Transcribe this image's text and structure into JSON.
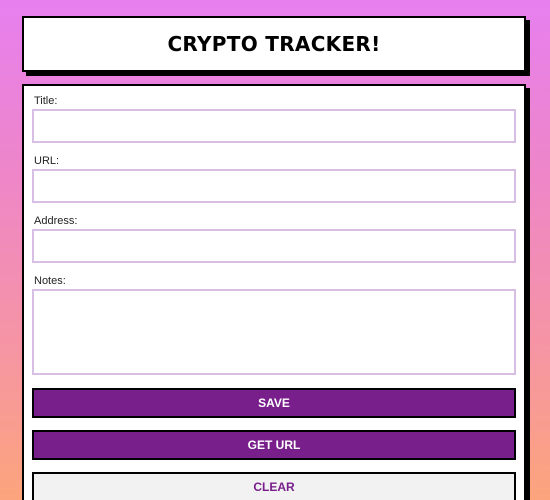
{
  "header": {
    "title": "CRYPTO TRACKER!"
  },
  "form": {
    "fields": [
      {
        "label": "Title:",
        "value": "",
        "placeholder": ""
      },
      {
        "label": "URL:",
        "value": "",
        "placeholder": ""
      },
      {
        "label": "Address:",
        "value": "",
        "placeholder": ""
      },
      {
        "label": "Notes:",
        "value": "",
        "placeholder": ""
      }
    ],
    "buttons": {
      "save": "SAVE",
      "get_url": "GET URL",
      "clear": "CLEAR"
    }
  },
  "colors": {
    "primary": "#791f8c",
    "input_border": "#d8bde4",
    "secondary_bg": "#f2f2f2"
  }
}
